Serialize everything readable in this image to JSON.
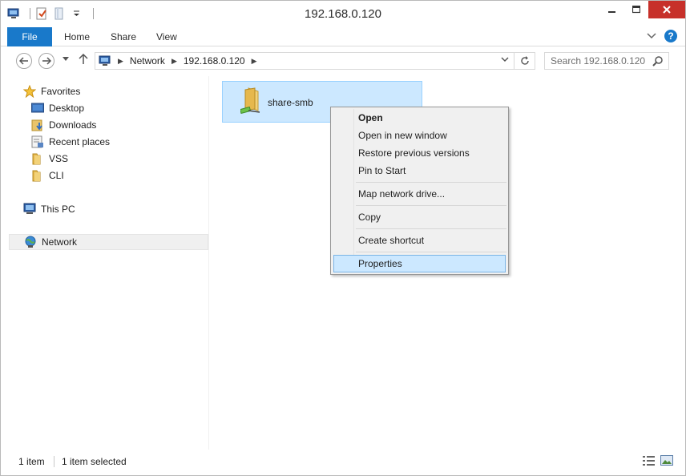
{
  "window": {
    "title": "192.168.0.120"
  },
  "ribbon": {
    "tabs": [
      {
        "label": "File"
      },
      {
        "label": "Home"
      },
      {
        "label": "Share"
      },
      {
        "label": "View"
      }
    ],
    "accent": "#1979CA"
  },
  "addressbar": {
    "crumbs": [
      "Network",
      "192.168.0.120"
    ],
    "search_placeholder": "Search 192.168.0.120"
  },
  "navpane": {
    "favorites": {
      "label": "Favorites",
      "items": [
        {
          "label": "Desktop",
          "icon": "desktop-icon"
        },
        {
          "label": "Downloads",
          "icon": "downloads-icon"
        },
        {
          "label": "Recent places",
          "icon": "recent-places-icon"
        },
        {
          "label": "VSS",
          "icon": "folder-icon"
        },
        {
          "label": "CLI",
          "icon": "folder-icon"
        }
      ]
    },
    "this_pc": {
      "label": "This PC"
    },
    "network": {
      "label": "Network"
    }
  },
  "content": {
    "items": [
      {
        "label": "share-smb",
        "selected": true
      }
    ]
  },
  "context_menu": {
    "items": [
      {
        "label": "Open",
        "bold": true
      },
      {
        "label": "Open in new window"
      },
      {
        "label": "Restore previous versions"
      },
      {
        "label": "Pin to Start"
      },
      {
        "label": "Map network drive..."
      },
      {
        "label": "Copy"
      },
      {
        "label": "Create shortcut"
      },
      {
        "label": "Properties",
        "highlighted": true
      }
    ]
  },
  "statusbar": {
    "item_count": "1 item",
    "selected_count": "1 item selected"
  }
}
